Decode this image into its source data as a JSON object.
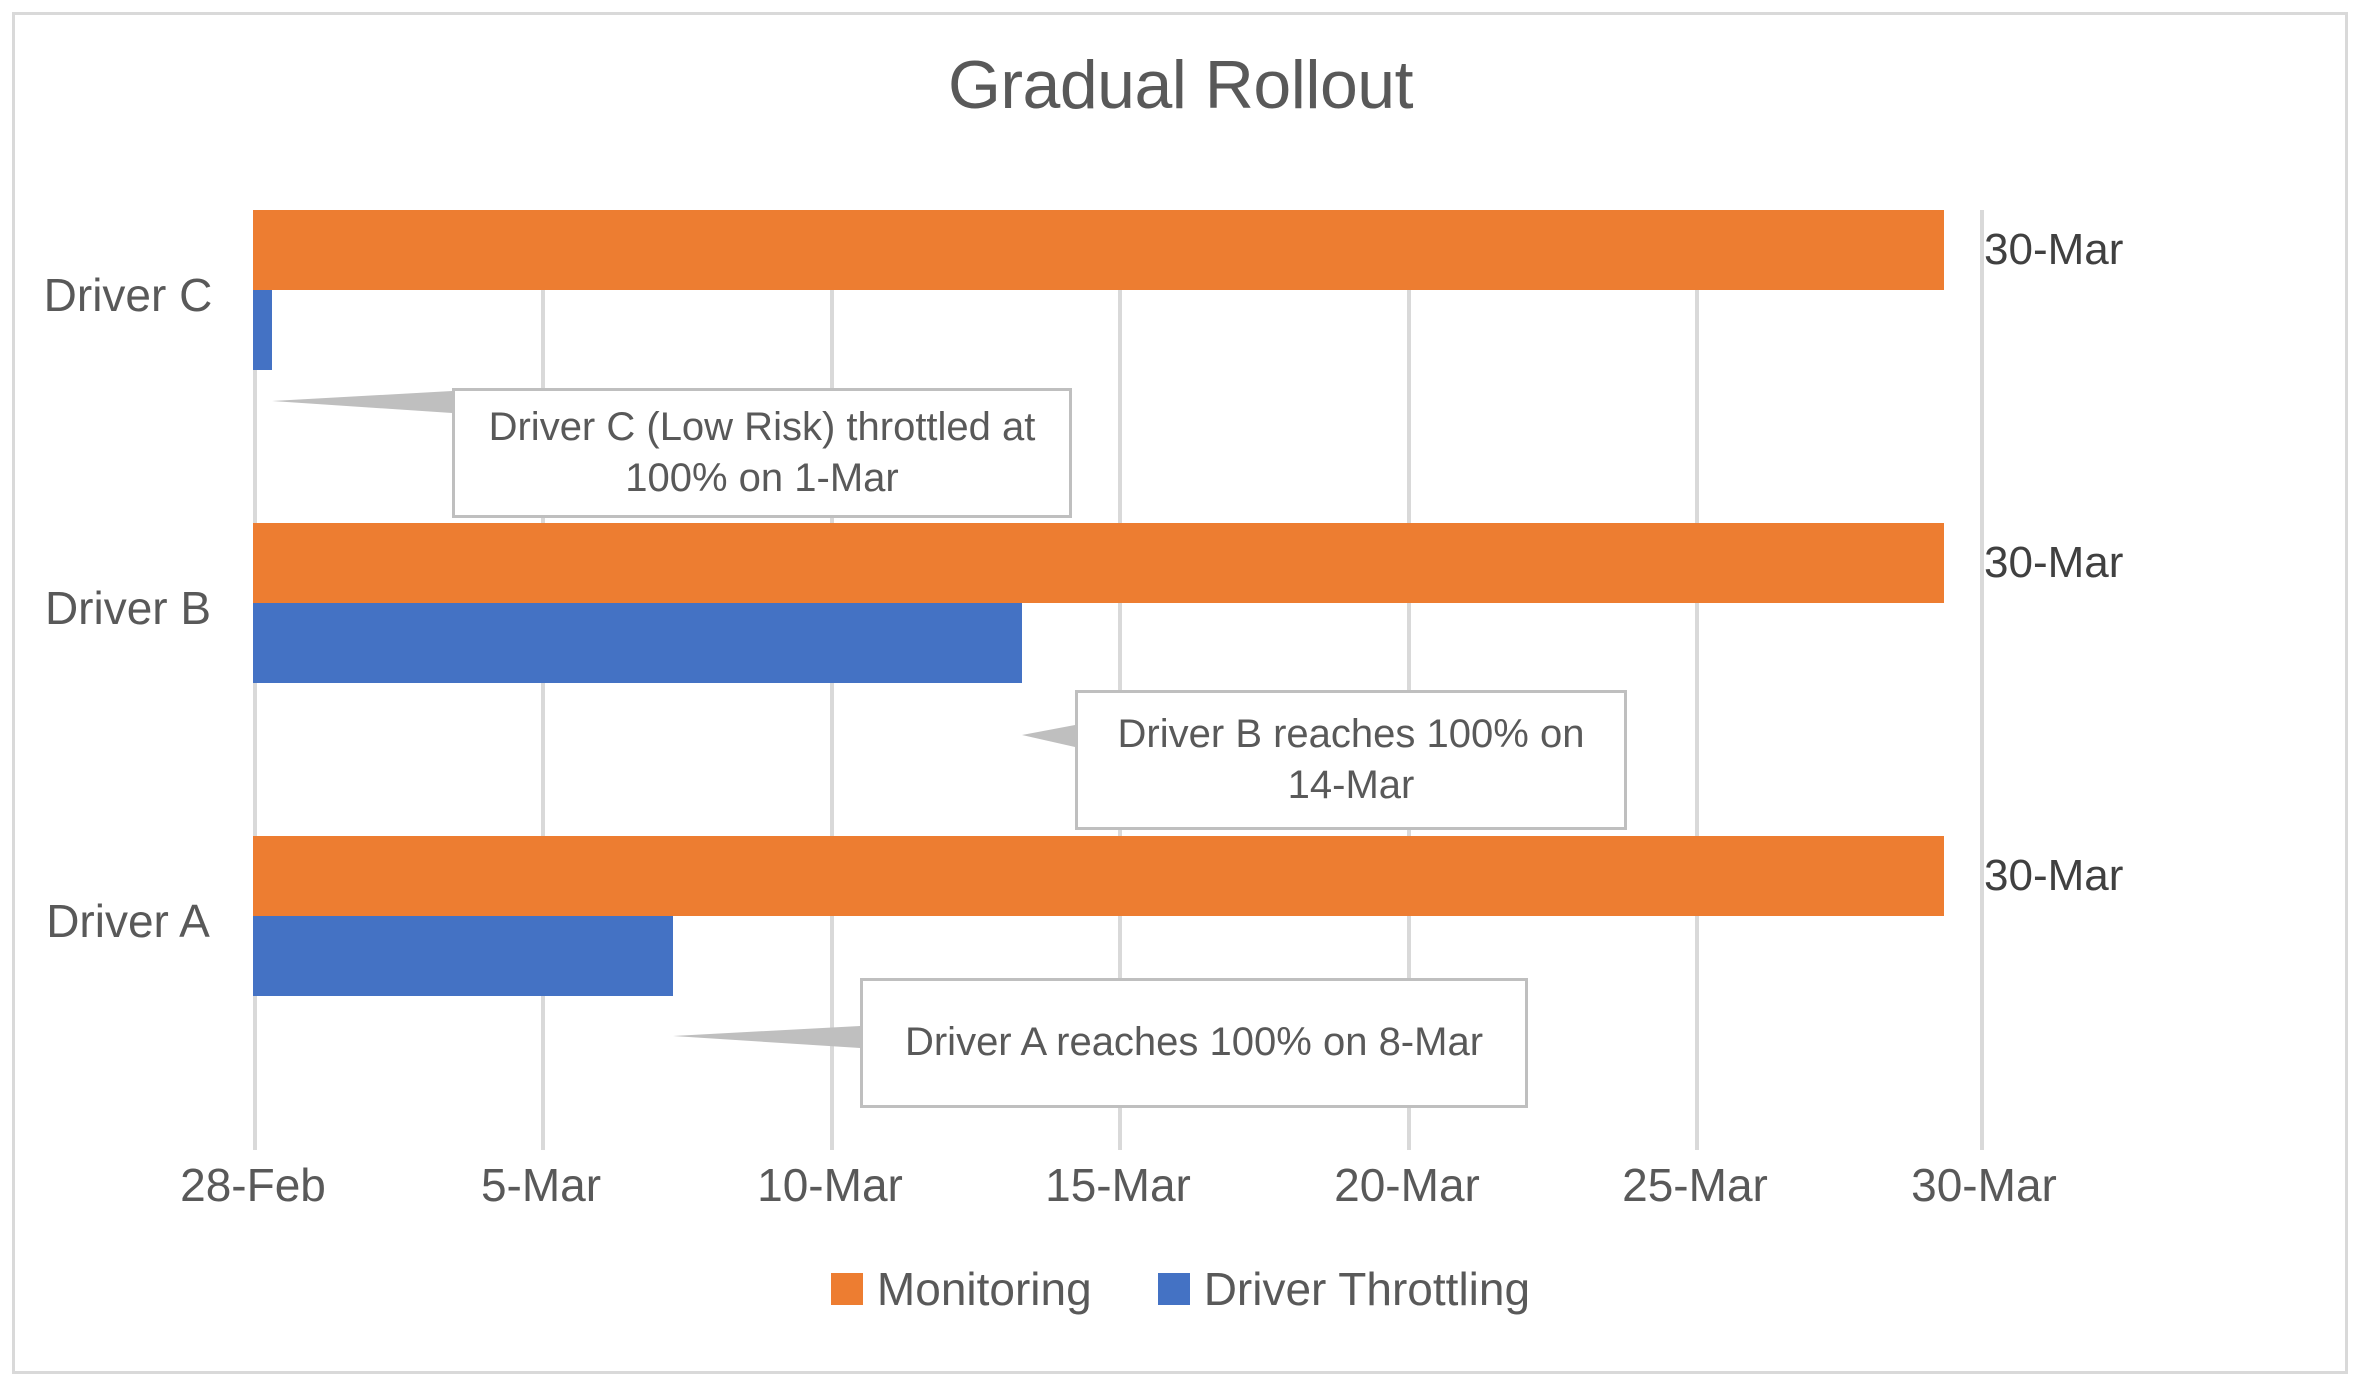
{
  "chart": {
    "title": "Gradual Rollout",
    "colors": {
      "monitoring": "#ED7D31",
      "throttling": "#4472C4",
      "gridline": "#d9d9d9",
      "text": "#595959",
      "callout_border": "#bfbfbf",
      "frame_border": "#d9d9d9"
    }
  },
  "legend": {
    "items": [
      {
        "label": "Monitoring",
        "color": "#ED7D31",
        "swatch": "legend-swatch-monitoring"
      },
      {
        "label": "Driver Throttling",
        "color": "#4472C4",
        "swatch": "legend-swatch-throttling"
      }
    ]
  },
  "x_axis": {
    "ticks": [
      "28-Feb",
      "5-Mar",
      "10-Mar",
      "15-Mar",
      "20-Mar",
      "25-Mar",
      "30-Mar"
    ]
  },
  "categories": [
    "Driver A",
    "Driver B",
    "Driver C"
  ],
  "value_labels": {
    "driver_a": "30-Mar",
    "driver_b": "30-Mar",
    "driver_c": "30-Mar"
  },
  "callouts": [
    {
      "id": "callout-driver-c",
      "text": "Driver C (Low Risk) throttled at 100% on 1-Mar"
    },
    {
      "id": "callout-driver-b",
      "text": "Driver B reaches 100% on 14-Mar"
    },
    {
      "id": "callout-driver-a",
      "text": "Driver A reaches 100% on 8-Mar"
    }
  ],
  "chart_data": {
    "type": "bar",
    "orientation": "horizontal",
    "title": "Gradual Rollout",
    "subtitle": "",
    "xlabel": "",
    "ylabel": "",
    "categories": [
      "Driver A",
      "Driver B",
      "Driver C"
    ],
    "category_order_top_to_bottom": [
      "Driver C",
      "Driver B",
      "Driver A"
    ],
    "x_tick_labels": [
      "28-Feb",
      "5-Mar",
      "10-Mar",
      "15-Mar",
      "20-Mar",
      "25-Mar",
      "30-Mar"
    ],
    "x_axis_range": [
      "28-Feb",
      "30-Mar"
    ],
    "grid": true,
    "grid_axis": "x",
    "legend_position": "bottom",
    "series": [
      {
        "name": "Monitoring",
        "color": "#ED7D31",
        "values": [
          {
            "category": "Driver A",
            "end": "30-Mar",
            "length_days": 30,
            "data_label": "30-Mar"
          },
          {
            "category": "Driver B",
            "end": "30-Mar",
            "length_days": 30,
            "data_label": "30-Mar"
          },
          {
            "category": "Driver C",
            "end": "30-Mar",
            "length_days": 30,
            "data_label": "30-Mar"
          }
        ]
      },
      {
        "name": "Driver Throttling",
        "color": "#4472C4",
        "values": [
          {
            "category": "Driver A",
            "end": "8-Mar",
            "length_days": 8,
            "data_label": ""
          },
          {
            "category": "Driver B",
            "end": "14-Mar",
            "length_days": 14,
            "data_label": ""
          },
          {
            "category": "Driver C",
            "end": "1-Mar",
            "length_days": 1,
            "data_label": ""
          }
        ]
      }
    ],
    "annotations": [
      {
        "target": "Driver C / Driver Throttling",
        "text": "Driver C (Low Risk) throttled at 100% on 1-Mar"
      },
      {
        "target": "Driver B / Driver Throttling",
        "text": "Driver B reaches 100% on 14-Mar"
      },
      {
        "target": "Driver A / Driver Throttling",
        "text": "Driver A reaches 100% on 8-Mar"
      }
    ]
  }
}
